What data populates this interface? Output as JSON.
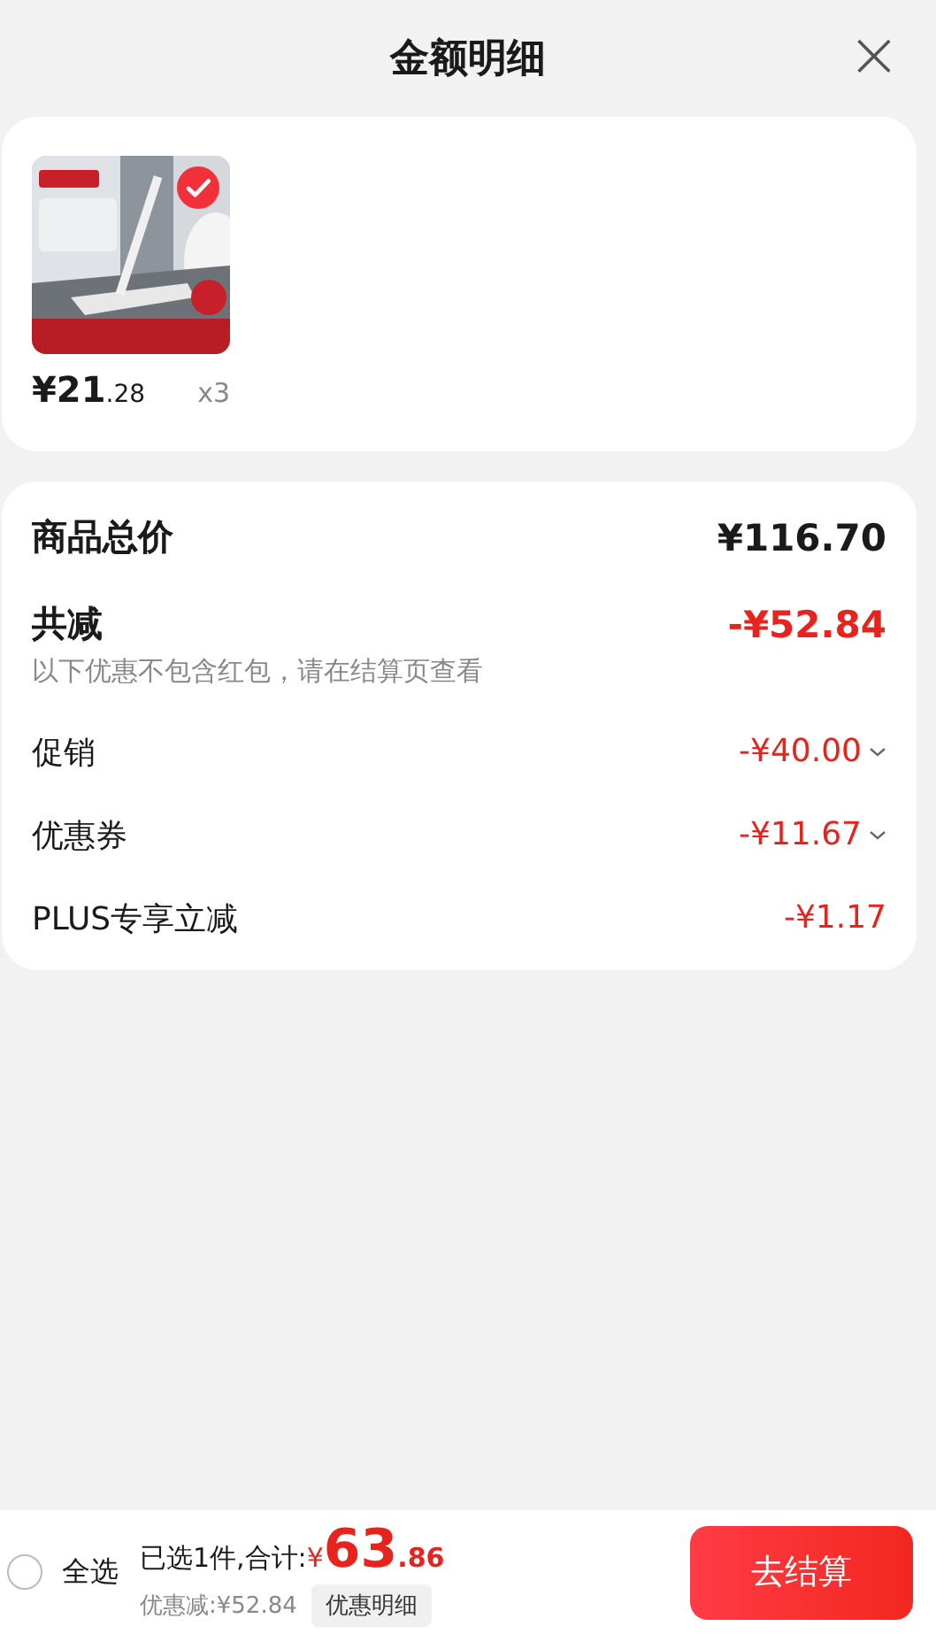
{
  "header": {
    "title": "金额明细",
    "close": "×"
  },
  "product": {
    "selected": true,
    "price_main": "¥21",
    "price_decimal": ".28",
    "quantity": "x3"
  },
  "summary": {
    "total_label": "商品总价",
    "total_value": "¥116.70",
    "discount_label": "共减",
    "discount_value": "-¥52.84",
    "note": "以下优惠不包含红包，请在结算页查看",
    "rows": [
      {
        "label": "促销",
        "value": "-¥40.00",
        "expandable": true
      },
      {
        "label": "优惠券",
        "value": "-¥11.67",
        "expandable": true
      },
      {
        "label": "PLUS专享立减",
        "value": "-¥1.17",
        "expandable": false
      }
    ]
  },
  "footer": {
    "select_all": {
      "label": "全选",
      "checked": false
    },
    "selected_text": "已选1件,合计:",
    "currency": "¥",
    "total_integer": "63",
    "total_decimal": ".86",
    "saved_text": "优惠减:¥52.84",
    "details_button": "优惠明细",
    "checkout_button": "去结算"
  }
}
